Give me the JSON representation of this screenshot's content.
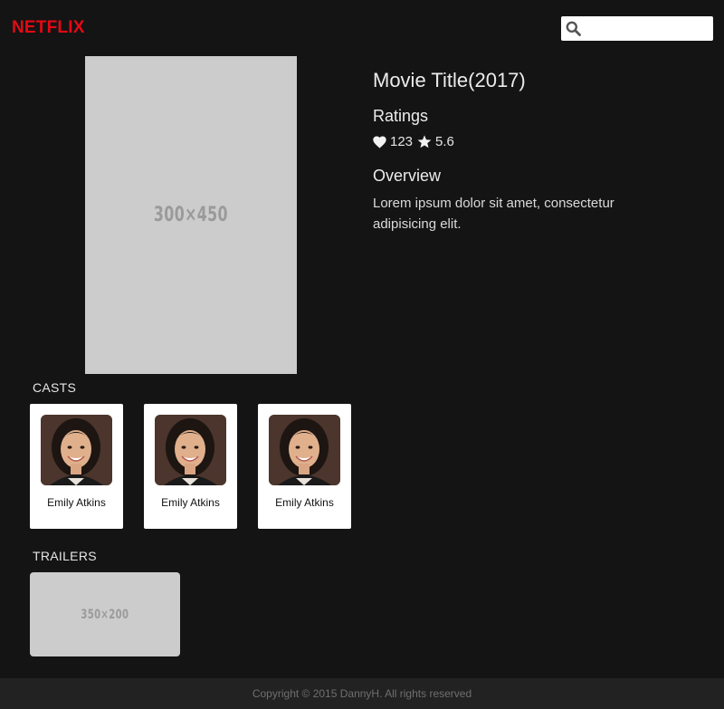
{
  "header": {
    "logo": "NETFLIX",
    "search": {
      "placeholder": "",
      "value": ""
    }
  },
  "movie": {
    "poster_placeholder": "300×450",
    "title": "Movie Title(2017)",
    "ratings_heading": "Ratings",
    "likes": "123",
    "score": "5.6",
    "overview_heading": "Overview",
    "overview": "Lorem ipsum dolor sit amet, consectetur adipisicing elit."
  },
  "casts": {
    "heading": "CASTS",
    "items": [
      {
        "name": "Emily Atkins"
      },
      {
        "name": "Emily Atkins"
      },
      {
        "name": "Emily Atkins"
      }
    ]
  },
  "trailers": {
    "heading": "TRAILERS",
    "items": [
      {
        "placeholder": "350×200"
      }
    ]
  },
  "footer": {
    "copyright": "Copyright © 2015 DannyH. All rights reserved"
  },
  "colors": {
    "background": "#141414",
    "brand": "#e50914",
    "placeholder": "#cccccc",
    "footer": "#222222"
  },
  "icons": [
    "search-icon",
    "heart-icon",
    "star-icon"
  ]
}
